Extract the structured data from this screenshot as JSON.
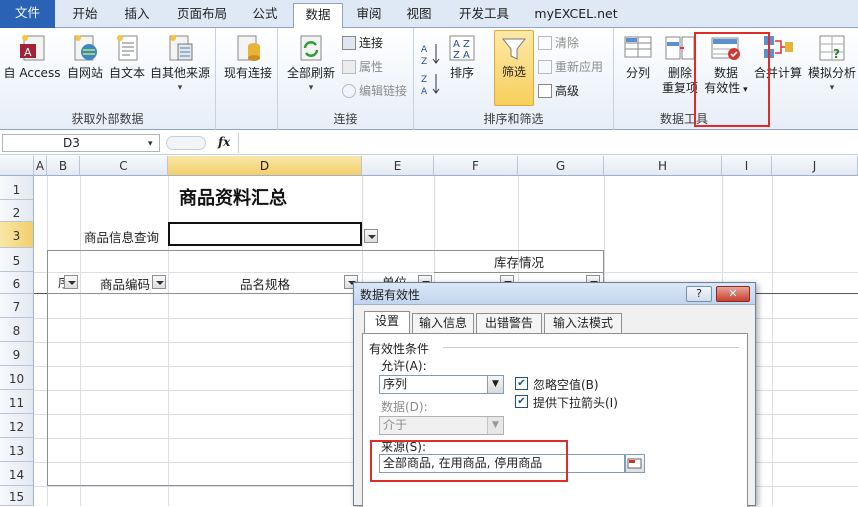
{
  "ribbon": {
    "tabs": [
      "文件",
      "开始",
      "插入",
      "页面布局",
      "公式",
      "数据",
      "审阅",
      "视图",
      "开发工具",
      "myEXCEL.net"
    ],
    "groups": {
      "external": {
        "label": "获取外部数据",
        "buttons": [
          "自 Access",
          "自网站",
          "自文本",
          "自其他来源"
        ]
      },
      "existing": {
        "label": "现有连接"
      },
      "connections": {
        "label": "连接",
        "refresh": "全部刷新",
        "connect": "连接",
        "properties": "属性",
        "edit_links": "编辑链接"
      },
      "sortfilter": {
        "label": "排序和筛选",
        "sort": "排序",
        "filter": "筛选",
        "clear": "清除",
        "reapply": "重新应用",
        "advanced": "高级"
      },
      "datatools": {
        "label": "数据工具",
        "split": "分列",
        "remove_dup_1": "删除",
        "remove_dup_2": "重复项",
        "validation_1": "数据",
        "validation_2": "有效性",
        "consolidate": "合并计算",
        "whatif": "模拟分析"
      }
    }
  },
  "formula_bar": {
    "cell_ref": "D3",
    "fx": "fx",
    "formula": ""
  },
  "sheet": {
    "columns": [
      "A",
      "B",
      "C",
      "D",
      "E",
      "F",
      "G",
      "H",
      "I",
      "J"
    ],
    "rows": [
      "1",
      "2",
      "3",
      "5",
      "6",
      "7",
      "8",
      "9",
      "10",
      "11",
      "12",
      "13",
      "14",
      "15"
    ],
    "title": "商品资料汇总",
    "query_label": "商品信息查询",
    "headers": {
      "seq": "序",
      "code": "商品编码",
      "name": "品名规格",
      "unit": "单位",
      "stock": "库存情况"
    }
  },
  "dialog": {
    "title": "数据有效性",
    "help": "?",
    "close": "✕",
    "tabs": [
      "设置",
      "输入信息",
      "出错警告",
      "输入法模式"
    ],
    "section": "有效性条件",
    "allow_label": "允许(A):",
    "allow_value": "序列",
    "data_label": "数据(D):",
    "data_value": "介于",
    "ignore_blank": "忽略空值(B)",
    "dropdown": "提供下拉箭头(I)",
    "source_label": "来源(S):",
    "source_value": "全部商品, 在用商品, 停用商品"
  },
  "colors": {
    "accent": "#2a62b5",
    "highlight": "#e02b2b",
    "selection": "#f3cf6b"
  }
}
